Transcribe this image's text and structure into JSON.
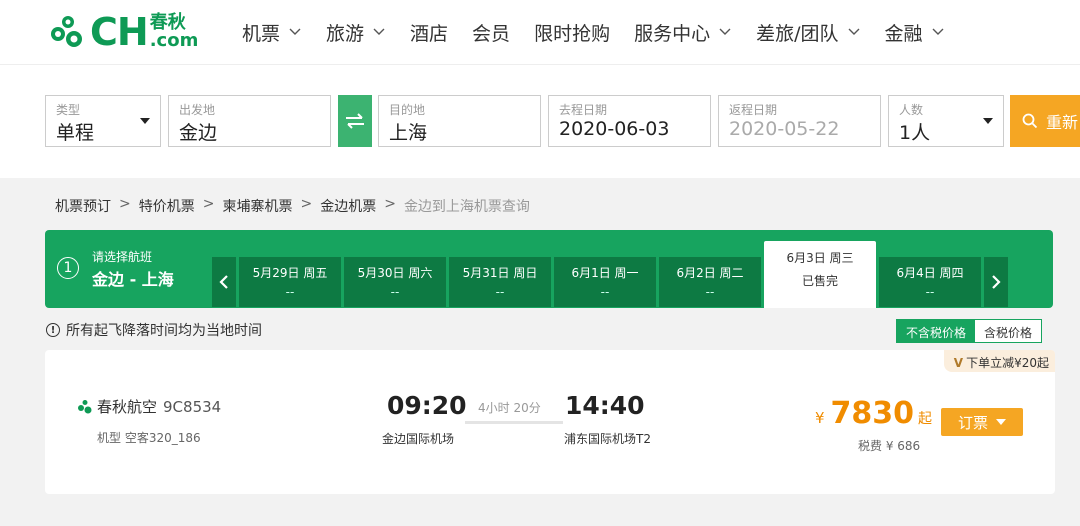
{
  "brand": {
    "logo_text": "CH",
    "logo_cn": "春秋",
    "logo_domain": ".com",
    "color": "#0e9a55"
  },
  "nav": {
    "items": [
      {
        "label": "机票",
        "dropdown": true
      },
      {
        "label": "旅游",
        "dropdown": true
      },
      {
        "label": "酒店",
        "dropdown": false
      },
      {
        "label": "会员",
        "dropdown": false
      },
      {
        "label": "限时抢购",
        "dropdown": false
      },
      {
        "label": "服务中心",
        "dropdown": true
      },
      {
        "label": "差旅/团队",
        "dropdown": true
      },
      {
        "label": "金融",
        "dropdown": true
      }
    ]
  },
  "search": {
    "type": {
      "label": "类型",
      "value": "单程"
    },
    "from": {
      "label": "出发地",
      "value": "金边"
    },
    "to": {
      "label": "目的地",
      "value": "上海"
    },
    "depart_date": {
      "label": "去程日期",
      "value": "2020-06-03"
    },
    "return_date": {
      "label": "返程日期",
      "value": "2020-05-22"
    },
    "passengers": {
      "label": "人数",
      "value": "1人"
    },
    "search_button": "重新"
  },
  "breadcrumb": {
    "items": [
      "机票预订",
      "特价机票",
      "柬埔寨机票",
      "金边机票"
    ],
    "separator": ">",
    "current": "金边到上海机票查询"
  },
  "step": {
    "number": "1",
    "title": "请选择航班",
    "route": "金边 - 上海"
  },
  "dates": [
    {
      "date": "5月29日 周五",
      "status": "--"
    },
    {
      "date": "5月30日 周六",
      "status": "--"
    },
    {
      "date": "5月31日 周日",
      "status": "--"
    },
    {
      "date": "6月1日 周一",
      "status": "--"
    },
    {
      "date": "6月2日 周二",
      "status": "--"
    },
    {
      "date": "6月3日 周三",
      "status": "已售完"
    },
    {
      "date": "6月4日 周四",
      "status": "--"
    }
  ],
  "notice": {
    "icon": "!",
    "text": "所有起飞降落时间均为当地时间"
  },
  "tax_toggle": {
    "exclusive": "不含税价格",
    "inclusive": "含税价格"
  },
  "flight": {
    "promo_mark": "V",
    "promo": "下单立减¥20起",
    "airline": "春秋航空",
    "flight_no": "9C8534",
    "aircraft": "机型 空客320_186",
    "dep_time": "09:20",
    "dep_airport": "金边国际机场",
    "duration": "4小时 20分",
    "arr_time": "14:40",
    "arr_airport": "浦东国际机场T2",
    "currency": "¥",
    "price": "7830",
    "price_suffix": "起",
    "tax": "税费 ¥ 686",
    "book_button": "订票"
  }
}
